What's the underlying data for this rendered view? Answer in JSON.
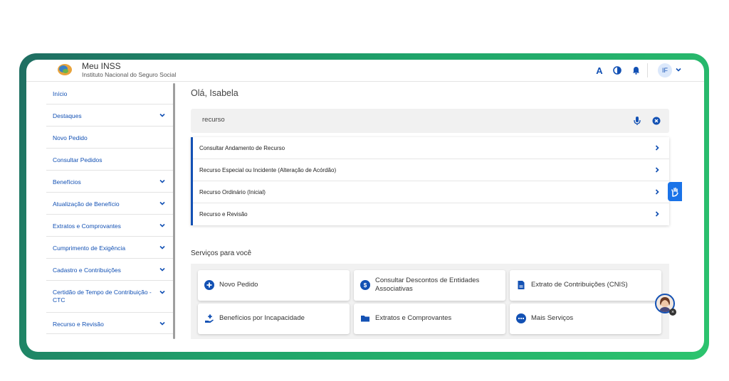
{
  "header": {
    "title": "Meu INSS",
    "subtitle": "Instituto Nacional do Seguro Social",
    "font_size_icon": "A",
    "user_initials": "IF"
  },
  "sidebar": {
    "items": [
      {
        "label": "Início",
        "expandable": false
      },
      {
        "label": "Destaques",
        "expandable": true
      },
      {
        "label": "Novo Pedido",
        "expandable": false
      },
      {
        "label": "Consultar Pedidos",
        "expandable": false
      },
      {
        "label": "Benefícios",
        "expandable": true
      },
      {
        "label": "Atualização de Benefício",
        "expandable": true
      },
      {
        "label": "Extratos e Comprovantes",
        "expandable": true
      },
      {
        "label": "Cumprimento de Exigência",
        "expandable": true
      },
      {
        "label": "Cadastro e Contribuições",
        "expandable": true
      },
      {
        "label": "Certidão de Tempo de Contribuição - CTC",
        "expandable": true
      },
      {
        "label": "Recurso e Revisão",
        "expandable": true
      }
    ]
  },
  "main": {
    "greeting": "Olá, Isabela",
    "search": {
      "value": "recurso",
      "placeholder": ""
    },
    "results": [
      {
        "label": "Consultar Andamento de Recurso"
      },
      {
        "label": "Recurso Especial ou Incidente (Alteração de Acórdão)"
      },
      {
        "label": "Recurso Ordinário (Inicial)"
      },
      {
        "label": "Recurso e Revisão"
      }
    ],
    "services_title": "Serviços para você",
    "services": [
      {
        "label": "Novo Pedido",
        "icon": "plus-circle-icon"
      },
      {
        "label": "Consultar Descontos de Entidades Associativas",
        "icon": "money-icon"
      },
      {
        "label": "Extrato de Contribuições (CNIS)",
        "icon": "document-icon"
      },
      {
        "label": "Benefícios por Incapacidade",
        "icon": "hand-plus-icon"
      },
      {
        "label": "Extratos e Comprovantes",
        "icon": "folder-icon"
      },
      {
        "label": "Mais Serviços",
        "icon": "more-icon"
      }
    ]
  },
  "colors": {
    "brand_blue": "#1351b4",
    "frame_gradient_start": "#1f6d62",
    "frame_gradient_end": "#2cc46e",
    "accessibility_blue": "#1a73e8"
  }
}
